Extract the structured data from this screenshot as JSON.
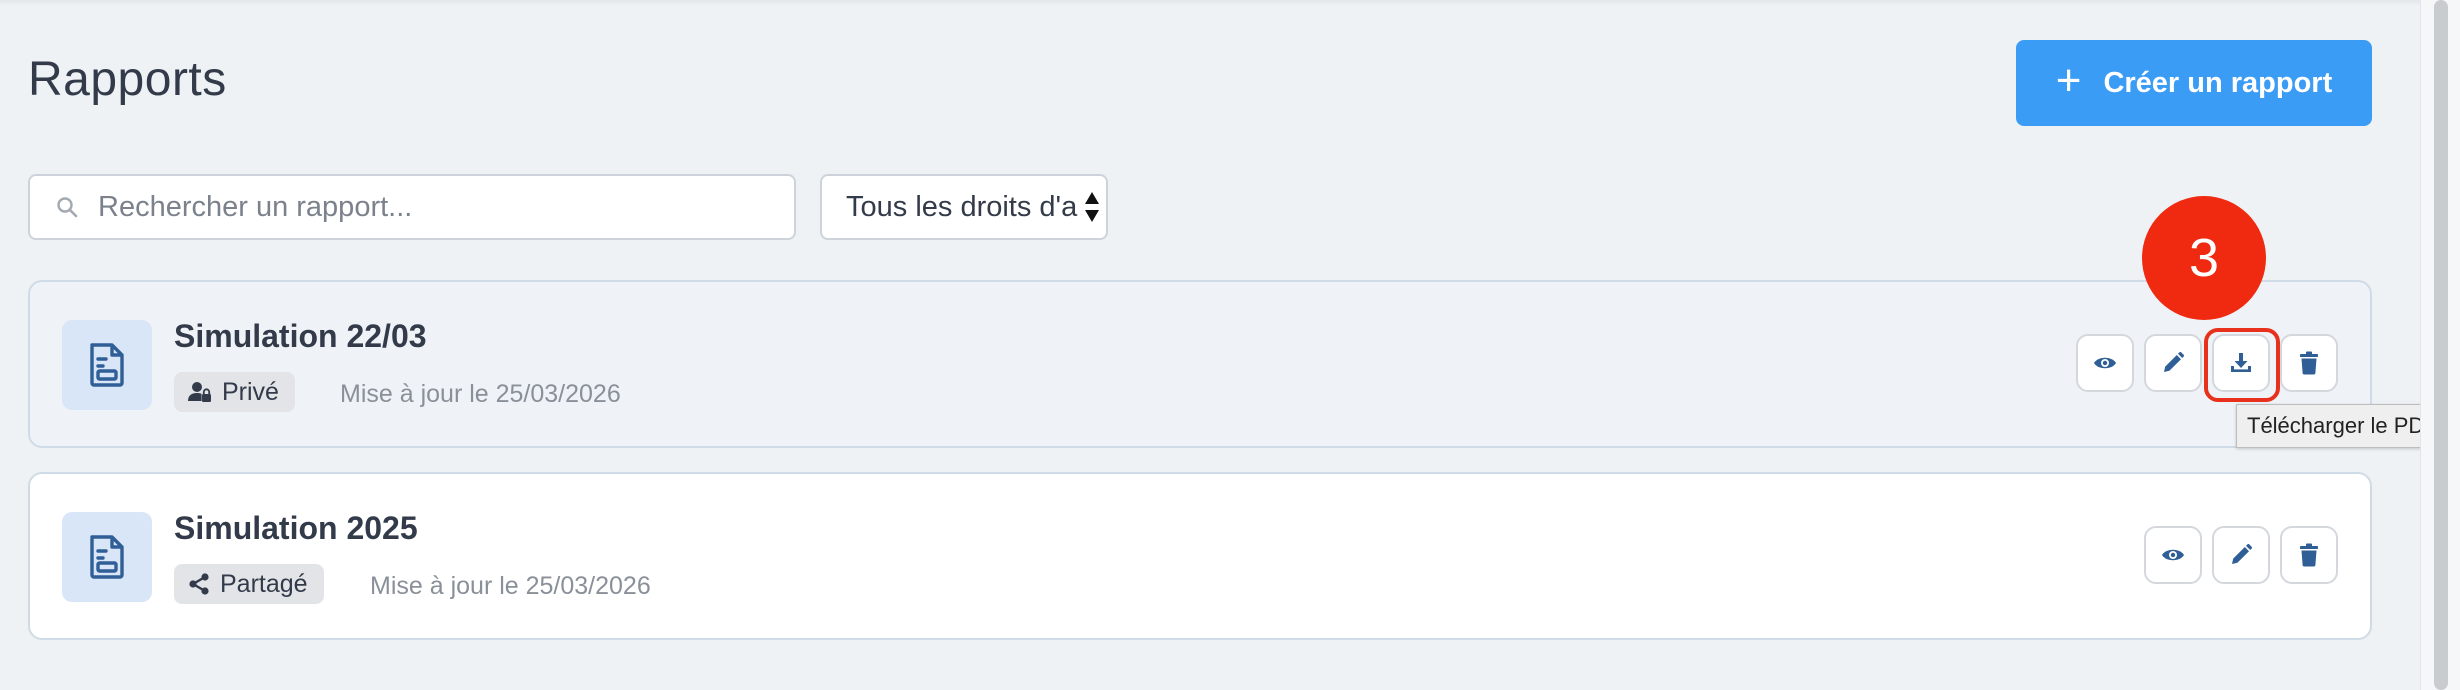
{
  "page": {
    "title": "Rapports"
  },
  "toolbar": {
    "create_label": "Créer un rapport"
  },
  "search": {
    "placeholder": "Rechercher un rapport...",
    "value": ""
  },
  "filter": {
    "selected": "Tous les droits d'a"
  },
  "reports": [
    {
      "title": "Simulation 22/03",
      "badge": "Privé",
      "updated": "Mise à jour le 25/03/2026",
      "actions": [
        "view",
        "edit",
        "download",
        "delete"
      ]
    },
    {
      "title": "Simulation 2025",
      "badge": "Partagé",
      "updated": "Mise à jour le 25/03/2026",
      "actions": [
        "view",
        "edit",
        "delete"
      ]
    }
  ],
  "annotation": {
    "step": "3"
  },
  "tooltip": {
    "text": "Télécharger le PDF"
  },
  "colors": {
    "accent": "#3b9cf6",
    "icon_blue": "#2f5f96",
    "annotation_red": "#f02a10",
    "background": "#eef2f5"
  },
  "icons": {
    "create": "plus-icon",
    "search": "search-icon",
    "report": "document-icon",
    "private": "user-lock-icon",
    "shared": "share-icon",
    "view": "eye-icon",
    "edit": "pencil-icon",
    "download": "download-icon",
    "delete": "trash-icon"
  }
}
